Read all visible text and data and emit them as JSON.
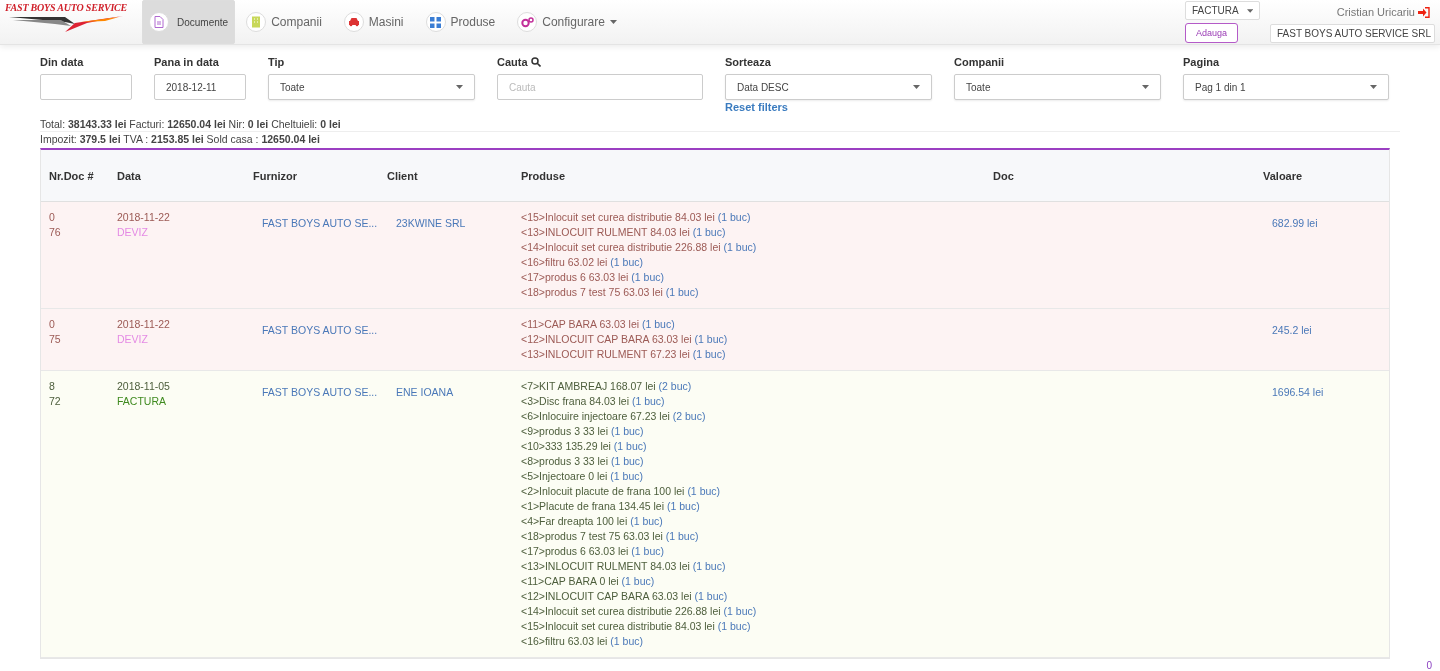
{
  "logo": {
    "text": "FAST BOYS AUTO SERVICE"
  },
  "nav": [
    {
      "label": "Documente",
      "selected": true,
      "dropdown": false
    },
    {
      "label": "Companii",
      "selected": false,
      "dropdown": false
    },
    {
      "label": "Masini",
      "selected": false,
      "dropdown": false
    },
    {
      "label": "Produse",
      "selected": false,
      "dropdown": false
    },
    {
      "label": "Configurare",
      "selected": false,
      "dropdown": true
    }
  ],
  "doc_type_select": {
    "value": "FACTURA"
  },
  "add_button": {
    "label": "Adauga"
  },
  "user": {
    "name": "Cristian Uricariu"
  },
  "company_select": {
    "value": "FAST BOYS AUTO SERVICE SRL"
  },
  "filters": [
    {
      "label": "Din data",
      "kind": "input"
    },
    {
      "label": "Pana in data",
      "kind": "input",
      "value": "2018-12-11"
    },
    {
      "label": "Tip",
      "kind": "select",
      "value": "Toate"
    },
    {
      "label": "Cauta",
      "kind": "search",
      "placeholder": "Cauta"
    },
    {
      "label": "Sorteaza",
      "kind": "select",
      "value": "Data DESC",
      "link": "Reset filters"
    },
    {
      "label": "Companii",
      "kind": "select",
      "value": "Toate"
    },
    {
      "label": "Pagina",
      "kind": "select",
      "value": "Pag 1 din 1"
    }
  ],
  "summary": [
    "Total: **38143.33 lei** Facturi: **12650.04 lei** Nir: **0 lei** Cheltuieli: **0 lei**",
    "Impozit: **379.5 lei** TVA : **2153.85 lei** Sold casa : **12650.04 lei**"
  ],
  "table": {
    "columns": [
      "Nr.Doc #",
      "Data",
      "Furnizor",
      "Client",
      "Produse",
      "Doc",
      "Valoare"
    ],
    "rows": [
      {
        "kind": "deviz",
        "nr": "0",
        "doc_no": "76",
        "date": "2018-11-22",
        "type": "DEVIZ",
        "supplier": "FAST BOYS AUTO SE...",
        "client": "23KWINE SRL",
        "value": "682.99 lei",
        "products": [
          {
            "name": "<15>Inlocuit set curea distributie 84.03 lei",
            "qty": "(1 buc)"
          },
          {
            "name": "<13>INLOCUIT RULMENT 84.03 lei",
            "qty": "(1 buc)"
          },
          {
            "name": "<14>Inlocuit set curea distributie 226.88 lei",
            "qty": "(1 buc)"
          },
          {
            "name": "<16>filtru 63.02 lei",
            "qty": "(1 buc)"
          },
          {
            "name": "<17>produs 6 63.03 lei",
            "qty": "(1 buc)"
          },
          {
            "name": "<18>produs 7 test 75 63.03 lei",
            "qty": "(1 buc)"
          }
        ]
      },
      {
        "kind": "deviz",
        "nr": "0",
        "doc_no": "75",
        "date": "2018-11-22",
        "type": "DEVIZ",
        "supplier": "FAST BOYS AUTO SE...",
        "value": "245.2 lei",
        "products": [
          {
            "name": "<11>CAP BARA 63.03 lei",
            "qty": "(1 buc)"
          },
          {
            "name": "<12>INLOCUIT CAP BARA 63.03 lei",
            "qty": "(1 buc)"
          },
          {
            "name": "<13>INLOCUIT RULMENT 67.23 lei",
            "qty": "(1 buc)"
          }
        ]
      },
      {
        "kind": "factura",
        "nr": "8",
        "doc_no": "72",
        "date": "2018-11-05",
        "type": "FACTURA",
        "supplier": "FAST BOYS AUTO SE...",
        "client": "ENE IOANA",
        "value": "1696.54 lei",
        "products": [
          {
            "name": "<7>KIT AMBREAJ 168.07 lei",
            "qty": "(2 buc)"
          },
          {
            "name": "<3>Disc frana 84.03 lei",
            "qty": "(1 buc)"
          },
          {
            "name": "<6>Inlocuire injectoare 67.23 lei",
            "qty": "(2 buc)"
          },
          {
            "name": "<9>produs 3 33 lei",
            "qty": "(1 buc)"
          },
          {
            "name": "<10>333 135.29 lei",
            "qty": "(1 buc)"
          },
          {
            "name": "<8>produs 3 33 lei",
            "qty": "(1 buc)"
          },
          {
            "name": "<5>Injectoare 0 lei",
            "qty": "(1 buc)"
          },
          {
            "name": "<2>Inlocuit placute de frana 100 lei",
            "qty": "(1 buc)"
          },
          {
            "name": "<1>Placute de frana 134.45 lei",
            "qty": "(1 buc)"
          },
          {
            "name": "<4>Far dreapta 100 lei",
            "qty": "(1 buc)"
          },
          {
            "name": "<18>produs 7 test 75 63.03 lei",
            "qty": "(1 buc)"
          },
          {
            "name": "<17>produs 6 63.03 lei",
            "qty": "(1 buc)"
          },
          {
            "name": "<13>INLOCUIT RULMENT 84.03 lei",
            "qty": "(1 buc)"
          },
          {
            "name": "<11>CAP BARA 0 lei",
            "qty": "(1 buc)"
          },
          {
            "name": "<12>INLOCUIT CAP BARA 63.03 lei",
            "qty": "(1 buc)"
          },
          {
            "name": "<14>Inlocuit set curea distributie 226.88 lei",
            "qty": "(1 buc)"
          },
          {
            "name": "<15>Inlocuit set curea distributie 84.03 lei",
            "qty": "(1 buc)"
          },
          {
            "name": "<16>filtru 63.03 lei",
            "qty": "(1 buc)"
          }
        ]
      }
    ]
  },
  "corner_badge": "0"
}
